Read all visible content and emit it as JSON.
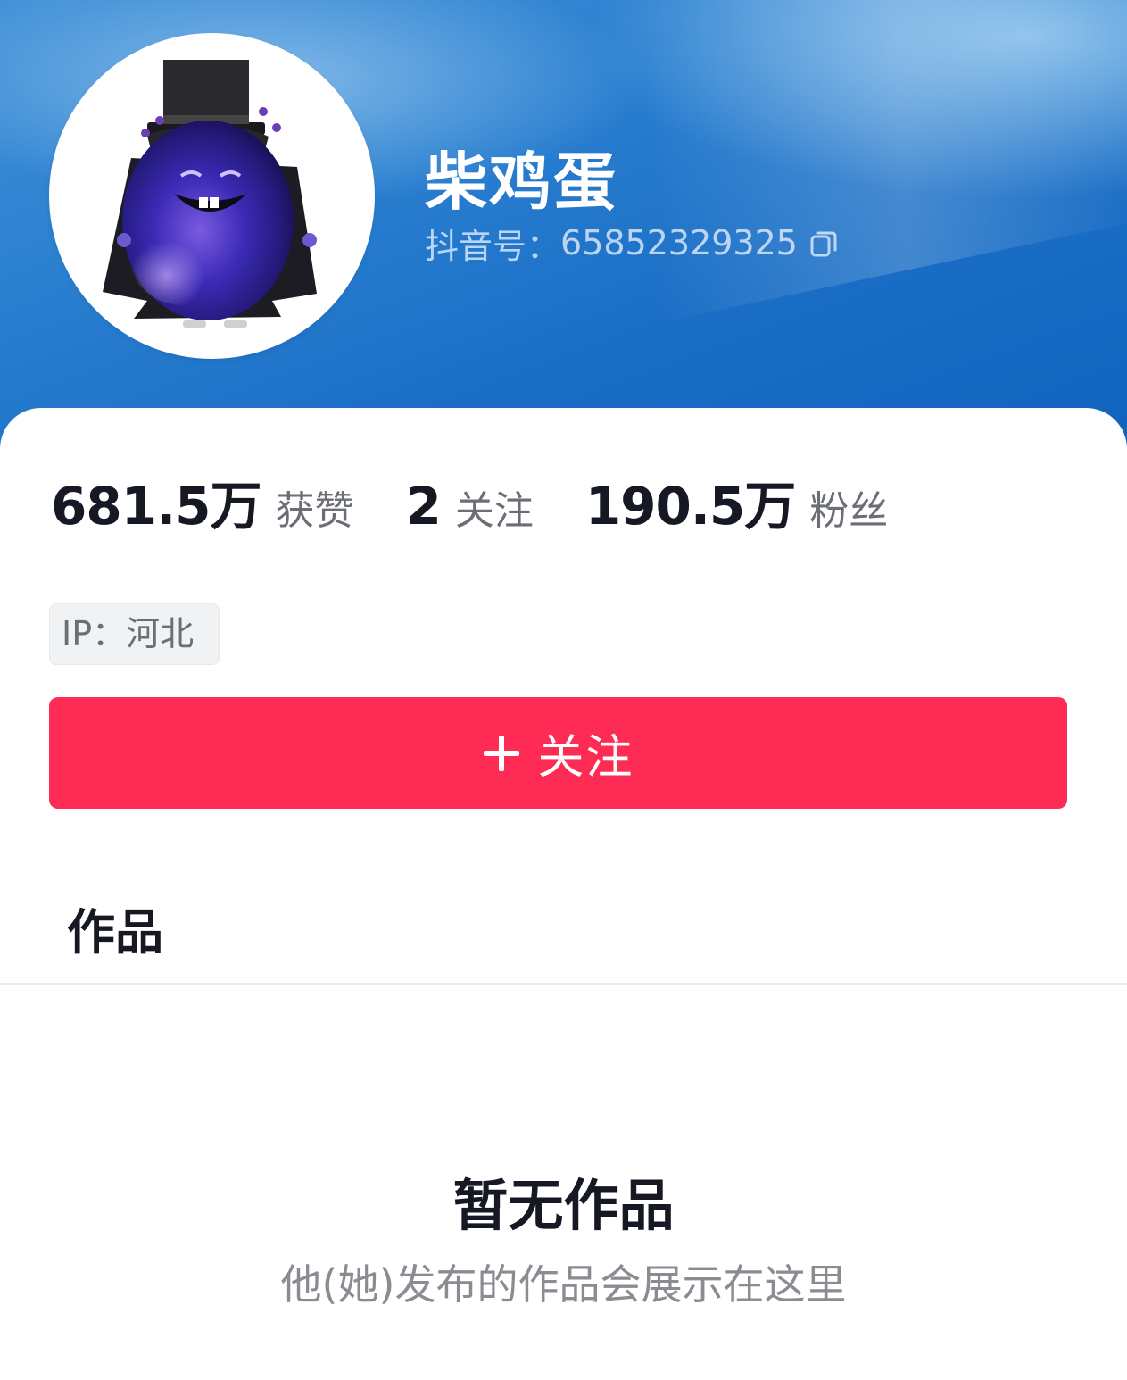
{
  "profile": {
    "name": "柴鸡蛋",
    "uid_label": "抖音号：",
    "uid_value": "65852329325"
  },
  "stats": [
    {
      "value": "681.5万",
      "label": "获赞"
    },
    {
      "value": "2",
      "label": "关注"
    },
    {
      "value": "190.5万",
      "label": "粉丝"
    }
  ],
  "ip_tag": "IP：河北",
  "follow_button": {
    "label": "关注"
  },
  "tabs": [
    {
      "label": "作品"
    }
  ],
  "empty_state": {
    "title": "暂无作品",
    "description": "他(她)发布的作品会展示在这里"
  },
  "icons": {
    "copy": "copy-icon",
    "plus": "plus-icon"
  },
  "colors": {
    "header_blue": "#1a6ec6",
    "follow_red": "#fe2c55",
    "text_dark": "#161823",
    "text_gray": "#6b6e75"
  }
}
